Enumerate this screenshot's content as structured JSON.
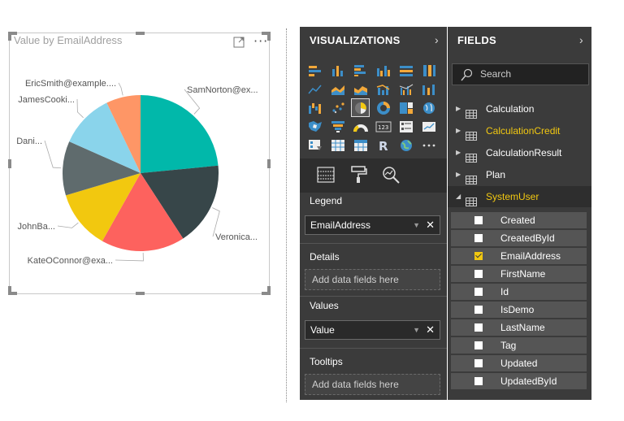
{
  "visual": {
    "title": "Value by EmailAddress",
    "more_label": "···"
  },
  "chart_data": {
    "type": "pie",
    "title": "Value by EmailAddress",
    "slices": [
      {
        "label": "SamNorton@ex...",
        "value": 23,
        "color": "#01B8AA"
      },
      {
        "label": "Veronica...",
        "value": 17,
        "color": "#374649"
      },
      {
        "label": "KateOConnor@exa...",
        "value": 17,
        "color": "#FD625E"
      },
      {
        "label": "JohnBa...",
        "value": 12,
        "color": "#F2C80F"
      },
      {
        "label": "Dani...",
        "value": 11,
        "color": "#5F6B6D"
      },
      {
        "label": "JamesCooki...",
        "value": 11,
        "color": "#8AD4EB"
      },
      {
        "label": "EricSmith@example....",
        "value": 7,
        "color": "#FE9666"
      }
    ],
    "legend": "none"
  },
  "visualizations": {
    "header": "VISUALIZATIONS",
    "chevron": "›",
    "wells": {
      "legend_label": "Legend",
      "legend_field": "EmailAddress",
      "details_label": "Details",
      "details_placeholder": "Add data fields here",
      "values_label": "Values",
      "values_field": "Value",
      "tooltips_label": "Tooltips",
      "tooltips_placeholder": "Add data fields here"
    },
    "remove_glyph": "✕",
    "dropdown_glyph": "▼"
  },
  "fields": {
    "header": "FIELDS",
    "chevron": "›",
    "search_placeholder": "Search",
    "tables": [
      {
        "name": "Calculation",
        "color": "#ffffff",
        "twist": "▶"
      },
      {
        "name": "CalculationCredit",
        "color": "#f2c811",
        "twist": "▶"
      },
      {
        "name": "CalculationResult",
        "color": "#ffffff",
        "twist": "▶"
      },
      {
        "name": "Plan",
        "color": "#ffffff",
        "twist": "▶"
      },
      {
        "name": "SystemUser",
        "color": "#f2c811",
        "twist": "◢"
      }
    ],
    "system_user_fields": [
      {
        "name": "Created",
        "checked": false
      },
      {
        "name": "CreatedById",
        "checked": false
      },
      {
        "name": "EmailAddress",
        "checked": true
      },
      {
        "name": "FirstName",
        "checked": false
      },
      {
        "name": "Id",
        "checked": false
      },
      {
        "name": "IsDemo",
        "checked": false
      },
      {
        "name": "LastName",
        "checked": false
      },
      {
        "name": "Tag",
        "checked": false
      },
      {
        "name": "Updated",
        "checked": false
      },
      {
        "name": "UpdatedById",
        "checked": false
      }
    ]
  }
}
